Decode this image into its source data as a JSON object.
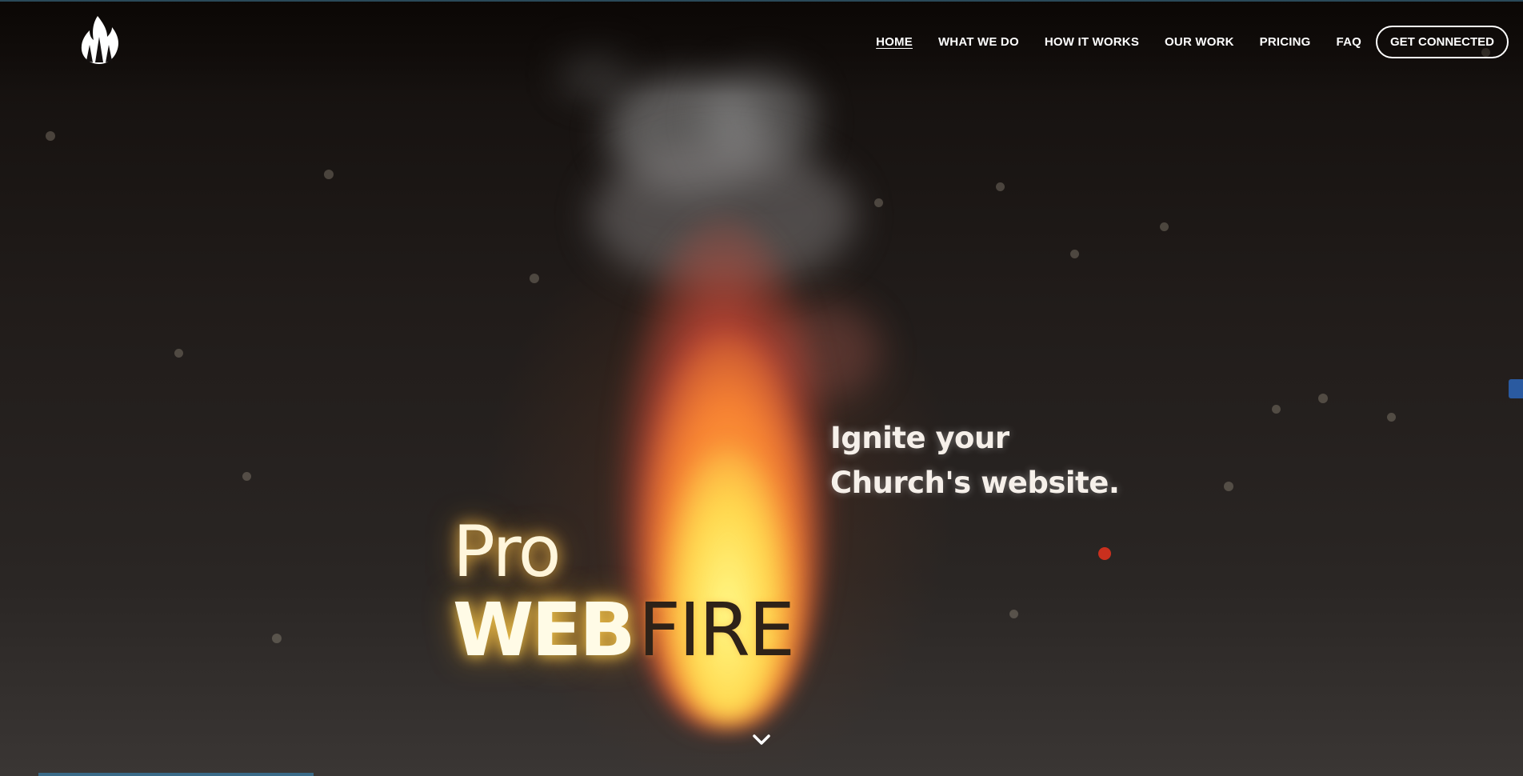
{
  "header": {
    "logo_icon": "flame-logo-icon",
    "nav": [
      {
        "label": "HOME",
        "active": true
      },
      {
        "label": "WHAT WE DO",
        "active": false
      },
      {
        "label": "HOW IT WORKS",
        "active": false
      },
      {
        "label": "OUR WORK",
        "active": false
      },
      {
        "label": "PRICING",
        "active": false
      },
      {
        "label": "FAQ",
        "active": false
      }
    ],
    "cta_label": "GET CONNECTED"
  },
  "hero": {
    "tagline_line1": "Ignite your",
    "tagline_line2": "Church's website.",
    "brand_pro": "Pro",
    "brand_web": "WEB",
    "brand_fire": "FIRE",
    "scroll_icon": "chevron-down-icon"
  },
  "colors": {
    "background": "#211c1a",
    "nav_text": "#ffffff",
    "flame_yellow": "#ffd84a",
    "flame_orange": "#ff7a2a",
    "brand_dark": "#2e2218"
  }
}
